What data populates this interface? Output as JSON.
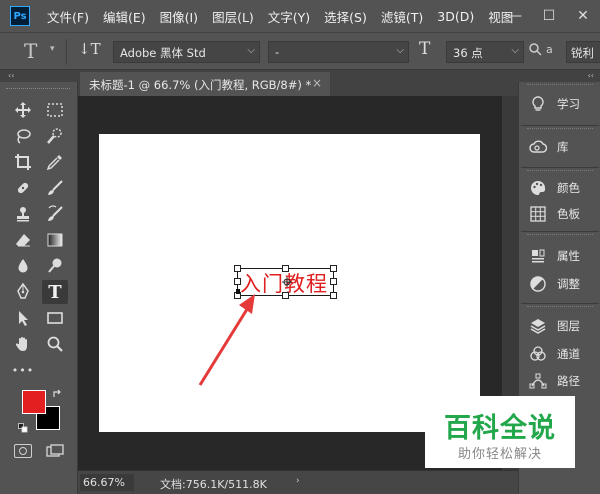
{
  "app": {
    "logo": "Ps"
  },
  "menu": [
    "文件(F)",
    "编辑(E)",
    "图像(I)",
    "图层(L)",
    "文字(Y)",
    "选择(S)",
    "滤镜(T)",
    "3D(D)",
    "视图"
  ],
  "window_controls": {
    "minimize": "—",
    "restore": "☐",
    "close": "✕"
  },
  "options": {
    "tool_icon": "T",
    "orientation_icon": "↓T",
    "font_family": "Adobe 黑体 Std",
    "font_style": "-",
    "size_icon": "T",
    "font_size": "36 点",
    "aa_icon": "a",
    "aa_label": "a",
    "anti_alias": "锐利"
  },
  "collapse_glyph": "‹‹",
  "document": {
    "tab_title": "未标题-1 @ 66.7% (入门教程, RGB/8#) *",
    "tab_close": "×",
    "text_layer": "入门教程",
    "text_color": "#e02020",
    "canvas_color": "#ffffff"
  },
  "status": {
    "zoom": "66.67%",
    "doc_info": "文档:756.1K/511.8K",
    "arrow": "›"
  },
  "colors": {
    "foreground": "#e31f1f",
    "background": "#000000"
  },
  "tools": {
    "more": "•••"
  },
  "panels": {
    "learn": "学习",
    "libraries": "库",
    "color": "颜色",
    "swatches": "色板",
    "properties": "属性",
    "adjustments": "调整",
    "layers": "图层",
    "channels": "通道",
    "paths": "路径"
  },
  "watermark": {
    "title": "百科全说",
    "subtitle": "助你轻松解决"
  }
}
